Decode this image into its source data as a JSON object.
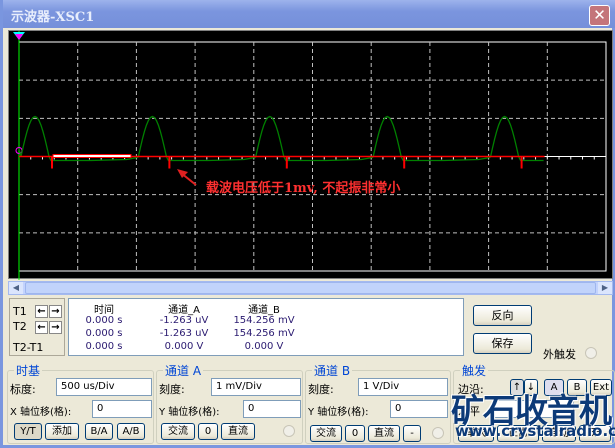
{
  "window": {
    "title": "示波器-XSC1",
    "close": "✕"
  },
  "annotation": "载波电压低于1mv, 不起振非常小",
  "colors": {
    "channel_a": "#ff0000",
    "channel_b": "#008000",
    "grid": "#c0c0c0"
  },
  "cursors": {
    "t1": "T1",
    "t2": "T2",
    "diff": "T2-T1"
  },
  "readout": {
    "headers": [
      "时间",
      "通道_A",
      "通道_B"
    ],
    "rows": [
      [
        "0.000 s",
        "-1.263 uV",
        "154.256 mV"
      ],
      [
        "0.000 s",
        "-1.263 uV",
        "154.256 mV"
      ],
      [
        "0.000 s",
        "0.000 V",
        "0.000 V"
      ]
    ]
  },
  "buttons": {
    "reverse": "反向",
    "save": "保存",
    "ext_trigger": "外触发"
  },
  "timebase": {
    "title": "时基",
    "scale_label": "标度:",
    "scale": "500 us/Div",
    "xpos_label": "X 轴位移(格):",
    "xpos": "0",
    "modes": [
      "Y/T",
      "添加",
      "B/A",
      "A/B"
    ]
  },
  "channel_a": {
    "title": "通道 A",
    "scale_label": "刻度:",
    "scale": "1 mV/Div",
    "ypos_label": "Y 轴位移(格):",
    "ypos": "0",
    "coupling": [
      "交流",
      "0",
      "直流"
    ]
  },
  "channel_b": {
    "title": "通道 B",
    "scale_label": "刻度:",
    "scale": "1  V/Div",
    "ypos_label": "Y 轴位移(格):",
    "ypos": "0",
    "coupling": [
      "交流",
      "0",
      "直流",
      "-"
    ]
  },
  "trigger": {
    "title": "触发",
    "edge_label": "边沿:",
    "level_label": "水平",
    "sources": [
      "A",
      "B",
      "Ext"
    ],
    "modes": [
      "单次",
      "正常",
      "自动",
      "无"
    ]
  },
  "watermark": {
    "brand": "矿石收音机",
    "url": "www.crystalradio.cn"
  }
}
